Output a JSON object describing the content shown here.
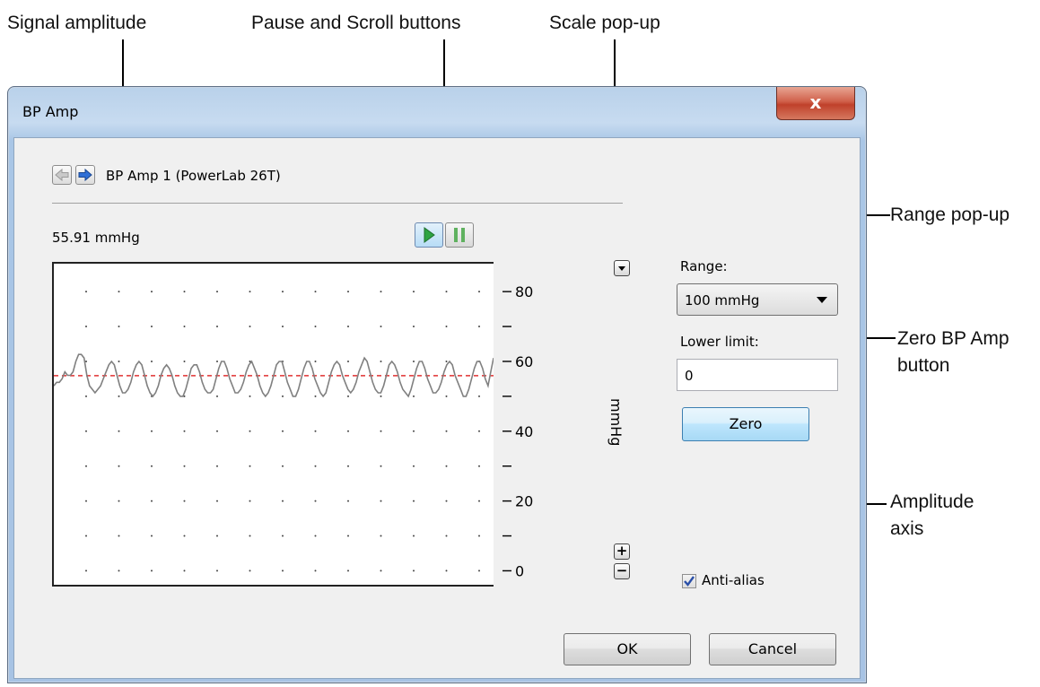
{
  "callouts": {
    "signal_amplitude": "Signal amplitude",
    "pause_scroll": "Pause and Scroll buttons",
    "scale_popup": "Scale pop-up",
    "range_popup": "Range pop-up",
    "zero_line1": "Zero BP Amp",
    "zero_line2": "button",
    "amplitude_line1": "Amplitude",
    "amplitude_line2": "axis"
  },
  "window": {
    "title": "BP Amp",
    "close_glyph": "x"
  },
  "device": {
    "name": "BP Amp 1 (PowerLab 26T)",
    "reading": "55.91 mmHg"
  },
  "controls": {
    "range_label": "Range:",
    "range_value": "100 mmHg",
    "lower_limit_label": "Lower limit:",
    "lower_limit_value": "0",
    "zero_label": "Zero",
    "anti_alias_label": "Anti-alias",
    "anti_alias_checked": true,
    "ok_label": "OK",
    "cancel_label": "Cancel",
    "plus": "+",
    "minus": "−"
  },
  "chart_data": {
    "type": "line",
    "ylabel": "mmHg",
    "ylim": [
      -4,
      88
    ],
    "yticks": [
      0,
      10,
      20,
      30,
      40,
      50,
      60,
      70,
      80
    ],
    "ytick_labels": [
      "0",
      "",
      "20",
      "",
      "40",
      "",
      "60",
      "",
      "80"
    ],
    "reference_line": 55.91,
    "reference_color": "#e03030",
    "series_color": "#808080",
    "x": [
      0,
      0.5,
      1,
      1.5,
      2,
      2.5,
      3,
      3.5,
      4,
      4.5,
      5,
      5.5,
      6,
      6.5,
      7,
      7.5,
      8,
      8.5,
      9,
      9.5,
      10,
      10.5,
      11,
      11.5,
      12,
      12.5,
      13,
      13.5,
      14,
      14.5,
      15,
      15.5,
      16,
      16.5,
      17,
      17.5,
      18,
      18.5,
      19,
      19.5,
      20,
      20.5,
      21,
      21.5,
      22,
      22.5,
      23,
      23.5,
      24,
      24.5,
      25,
      25.5,
      26,
      26.5,
      27,
      27.5,
      28,
      28.5,
      29,
      29.5,
      30,
      30.5,
      31,
      31.5,
      32,
      32.5,
      33,
      33.5,
      34,
      34.5,
      35,
      35.5,
      36,
      36.5,
      37,
      37.5,
      38,
      38.5,
      39,
      39.5,
      40,
      40.5,
      41,
      41.5,
      42,
      42.5,
      43,
      43.5,
      44,
      44.5,
      45,
      45.5,
      46,
      46.5,
      47,
      47.5,
      48,
      48.5,
      49,
      49.5,
      50,
      50.5,
      51,
      51.5,
      52,
      52.5,
      53,
      53.5,
      54,
      54.5,
      55,
      55.5,
      56,
      56.5,
      57,
      57.5,
      58,
      58.5,
      59,
      59.5,
      60,
      60.5,
      61,
      61.5,
      62,
      62.5,
      63,
      63.5,
      64,
      64.5,
      65,
      65.5,
      66,
      66.5,
      67,
      67.5,
      68,
      68.5,
      69,
      69.5,
      70,
      70.5,
      71,
      71.5,
      72,
      72.5,
      73,
      73.5,
      74,
      74.5,
      75,
      75.5,
      76,
      76.5,
      77,
      77.5,
      78,
      78.5,
      79,
      79.5,
      80
    ],
    "y": [
      53,
      54,
      54,
      55,
      57,
      56,
      56,
      57,
      60,
      62,
      62,
      61,
      56,
      53,
      52,
      51,
      52,
      53,
      55,
      57,
      59,
      60,
      59,
      56,
      53,
      51,
      51,
      52,
      54,
      57,
      59,
      60,
      59,
      56,
      53,
      51,
      50,
      51,
      53,
      56,
      58,
      59,
      58,
      56,
      53,
      51,
      50,
      50,
      52,
      55,
      58,
      59,
      59,
      57,
      54,
      52,
      51,
      51,
      52,
      55,
      58,
      60,
      60,
      58,
      55,
      53,
      51,
      51,
      52,
      54,
      57,
      59,
      60,
      58,
      56,
      53,
      51,
      50,
      51,
      53,
      56,
      59,
      60,
      60,
      57,
      54,
      52,
      50,
      50,
      52,
      55,
      58,
      60,
      60,
      58,
      55,
      53,
      51,
      50,
      51,
      54,
      57,
      59,
      60,
      59,
      56,
      54,
      52,
      51,
      52,
      54,
      57,
      59,
      61,
      60,
      57,
      54,
      52,
      51,
      51,
      53,
      56,
      59,
      60,
      59,
      57,
      54,
      52,
      51,
      50,
      52,
      55,
      58,
      60,
      60,
      58,
      55,
      53,
      51,
      51,
      52,
      54,
      57,
      59,
      60,
      59,
      56,
      54,
      52,
      50,
      50,
      52,
      55,
      58,
      60,
      60,
      58,
      55,
      53,
      57,
      61
    ]
  }
}
